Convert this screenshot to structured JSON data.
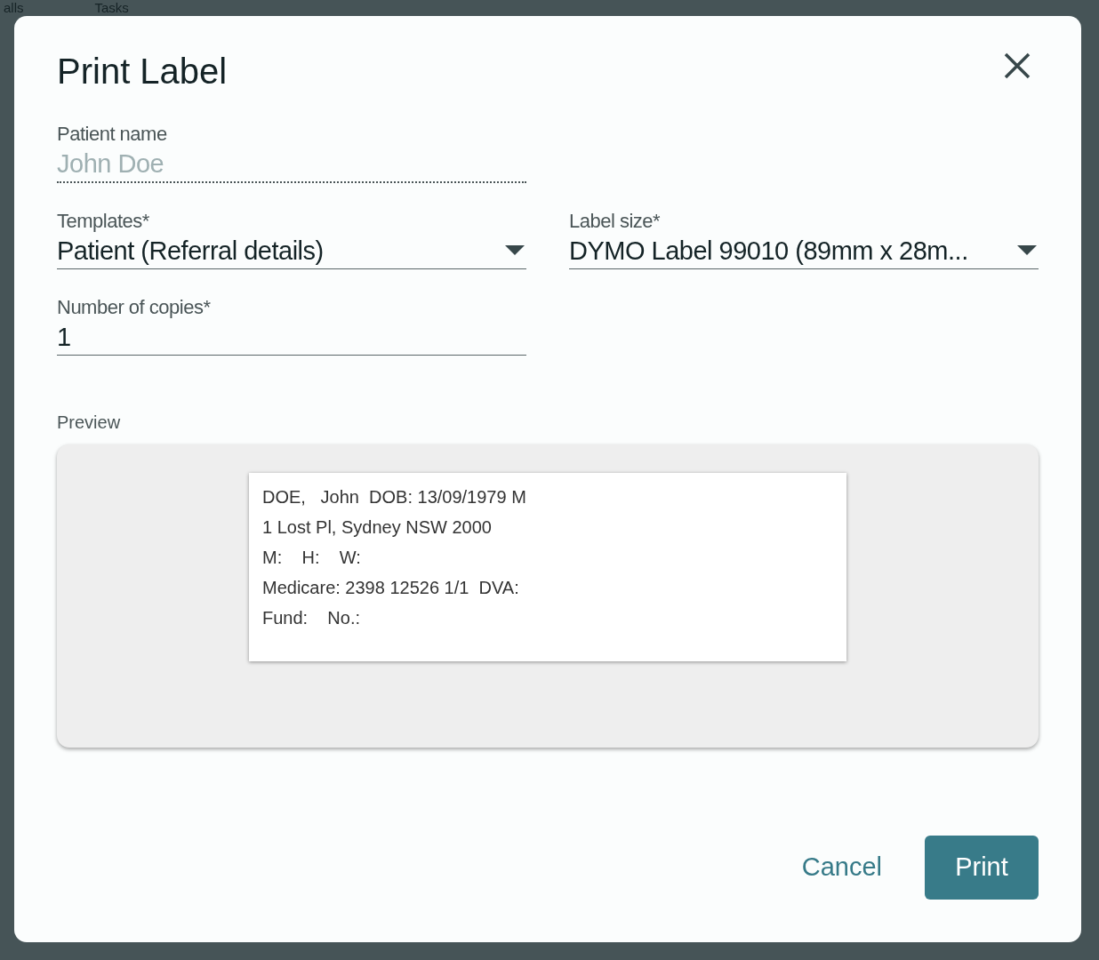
{
  "background": {
    "tabs": [
      "alls",
      "Tasks"
    ]
  },
  "dialog": {
    "title": "Print Label",
    "fields": [
      {
        "kind": "readonly",
        "label": "Patient name",
        "value": "John Doe"
      },
      {
        "kind": "select",
        "label": "Templates*",
        "value": "Patient (Referral details)"
      },
      {
        "kind": "select",
        "label": "Label size*",
        "value": "DYMO Label 99010 (89mm x 28m..."
      },
      {
        "kind": "input",
        "label": "Number of copies*",
        "value": "1"
      }
    ],
    "preview": {
      "label": "Preview",
      "lines": [
        "DOE,   John  DOB: 13/09/1979 M",
        "1 Lost Pl, Sydney NSW 2000",
        "M:    H:    W:",
        "Medicare: 2398 12526 1/1  DVA:",
        "Fund:    No.:"
      ]
    },
    "buttons": [
      {
        "kind": "text",
        "label": "Cancel"
      },
      {
        "kind": "primary",
        "label": "Print"
      }
    ]
  }
}
